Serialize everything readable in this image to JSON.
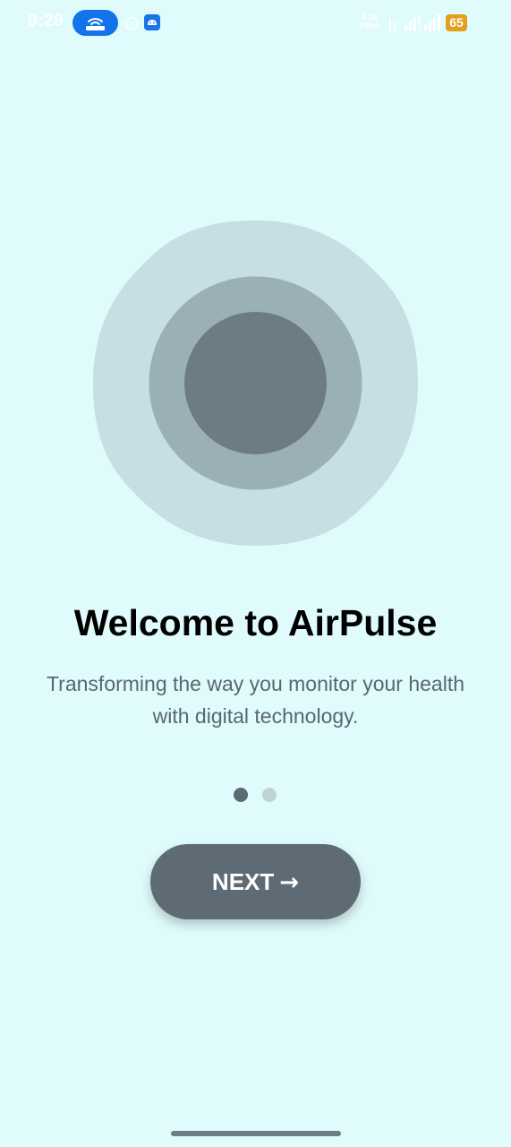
{
  "status_bar": {
    "time": "9:29",
    "network_speed_value": "0.16",
    "network_speed_unit": "KB/S",
    "battery_level": "65",
    "icons": [
      "hotspot-icon",
      "whatsapp-icon",
      "android-icon",
      "vowifi-icon",
      "signal-icon",
      "signal-icon",
      "battery-icon"
    ]
  },
  "onboarding": {
    "title": "Welcome to AirPulse",
    "subtitle": "Transforming the way you monitor your health with digital technology.",
    "page_count": 2,
    "current_page": 1,
    "next_label": "NEXT",
    "next_icon": "arrow-right-icon",
    "illustration_icon": "pulse-circles-icon"
  },
  "colors": {
    "background": "#e0fbfc",
    "outer_blob": "#c5dfe2",
    "middle_circle": "#9bb0b4",
    "inner_circle": "#6d7c82",
    "button": "#5f6b74",
    "dot_active": "#5c6a73",
    "dot_inactive": "#bfd3d6",
    "battery": "#e3a11b",
    "hotspot_pill": "#1273ea"
  }
}
